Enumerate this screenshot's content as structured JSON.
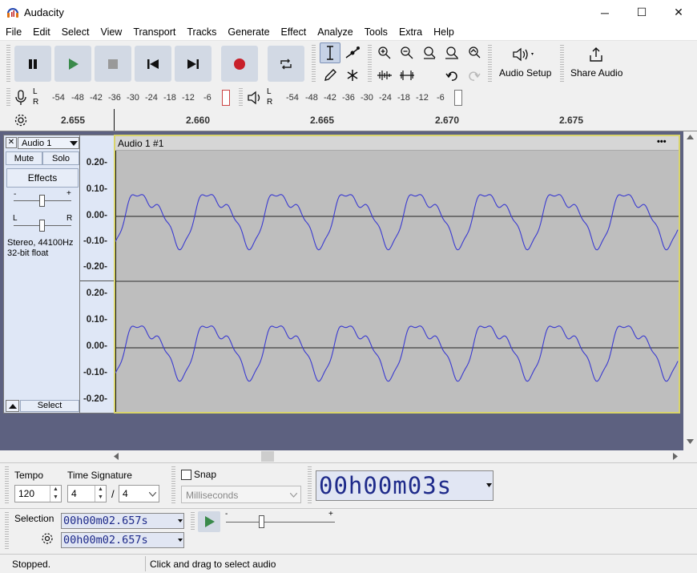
{
  "window": {
    "title": "Audacity",
    "minimize": "─",
    "maximize": "☐",
    "close": "✕"
  },
  "menu": [
    "File",
    "Edit",
    "Select",
    "View",
    "Transport",
    "Tracks",
    "Generate",
    "Effect",
    "Analyze",
    "Tools",
    "Extra",
    "Help"
  ],
  "toolbar": {
    "audio_setup": "Audio Setup",
    "share_audio": "Share Audio"
  },
  "meters": {
    "record_ticks": [
      "-54",
      "-48",
      "-42",
      "-36",
      "-30",
      "-24",
      "-18",
      "-12",
      "-6"
    ],
    "play_ticks": [
      "-54",
      "-48",
      "-42",
      "-36",
      "-30",
      "-24",
      "-18",
      "-12",
      "-6"
    ],
    "L": "L",
    "R": "R"
  },
  "ruler": [
    "2.655",
    "2.660",
    "2.665",
    "2.670",
    "2.675"
  ],
  "track": {
    "name": "Audio 1",
    "close": "✕",
    "mute": "Mute",
    "solo": "Solo",
    "effects": "Effects",
    "gain_minus": "-",
    "gain_plus": "+",
    "pan_left": "L",
    "pan_right": "R",
    "info_line1": "Stereo, 44100Hz",
    "info_line2": "32-bit float",
    "select": "Select",
    "clip_name": "Audio 1 #1",
    "clip_menu": "•••"
  },
  "scale": [
    "0.20-",
    "0.10-",
    "0.00-",
    "-0.10-",
    "-0.20-"
  ],
  "bottom": {
    "tempo_label": "Tempo",
    "tempo_value": "120",
    "timesig_label": "Time Signature",
    "timesig_num": "4",
    "timesig_sep": "/",
    "timesig_den": "4",
    "snap_label": "Snap",
    "snap_unit": "Milliseconds",
    "time_display": "00h00m03s",
    "selection_label": "Selection",
    "sel_start": "00h00m02.657s",
    "sel_end": "00h00m02.657s",
    "speed_minus": "-",
    "speed_plus": "+"
  },
  "status": {
    "state": "Stopped.",
    "hint": "Click and drag to select audio"
  },
  "colors": {
    "wave": "#3a3ad0",
    "record": "#c8202a",
    "play": "#3a8a4a",
    "button_bg": "#d2d9e4"
  }
}
